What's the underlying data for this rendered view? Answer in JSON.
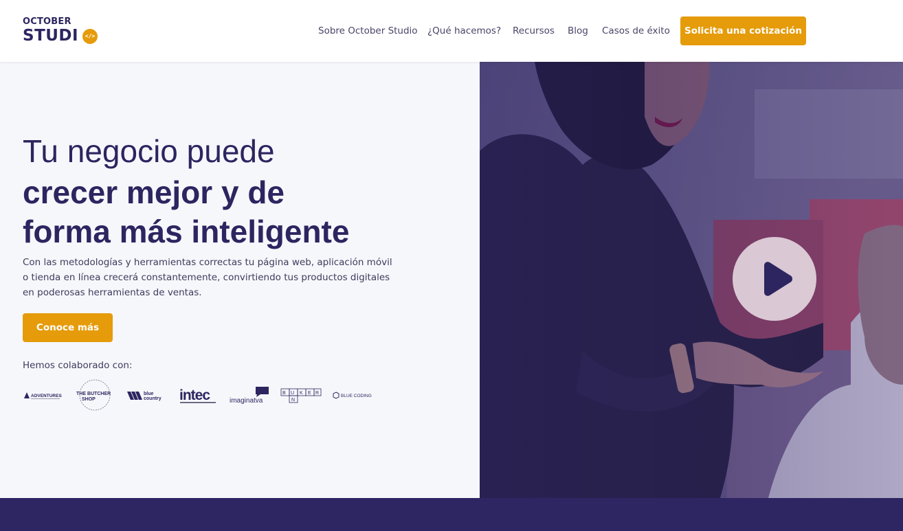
{
  "logo": {
    "line1": "OCTOBER",
    "line2": "STUDI",
    "badge": "</>"
  },
  "nav": {
    "items": [
      "Sobre October Studio",
      "¿Qué hacemos?",
      "Recursos",
      "Blog",
      "Casos de éxito"
    ],
    "cta": "Solicita una cotización"
  },
  "hero": {
    "headline_light": "Tu negocio puede",
    "headline_bold_1": "crecer mejor y de",
    "headline_bold_2": "forma más inteligente",
    "description": "Con las metodologías y herramientas correctas tu página web, aplicación móvil o tienda en línea crecerá constantemente, convirtiendo tus productos digitales en poderosas herramientas de ventas.",
    "cta": "Conoce más",
    "collab_label": "Hemos colaborado con:"
  },
  "partners": [
    {
      "name": "ADVENTURES",
      "icon": "adventures-logo"
    },
    {
      "name": "THE BUTCHER SHOP",
      "icon": "butcher-shop-logo"
    },
    {
      "name": "blue country",
      "icon": "blue-country-logo"
    },
    {
      "name": "intec",
      "icon": "intec-logo"
    },
    {
      "name": "imaginatva",
      "icon": "imaginatva-logo"
    },
    {
      "name": "BUNKER",
      "icon": "bunker-logo"
    },
    {
      "name": "BLUE CODING",
      "icon": "blue-coding-logo"
    }
  ],
  "video": {
    "icon": "play-icon"
  },
  "colors": {
    "accent": "#e59b0a",
    "primary": "#2d2560",
    "hero_bg": "#f6f7fb",
    "band": "#2e2563"
  }
}
